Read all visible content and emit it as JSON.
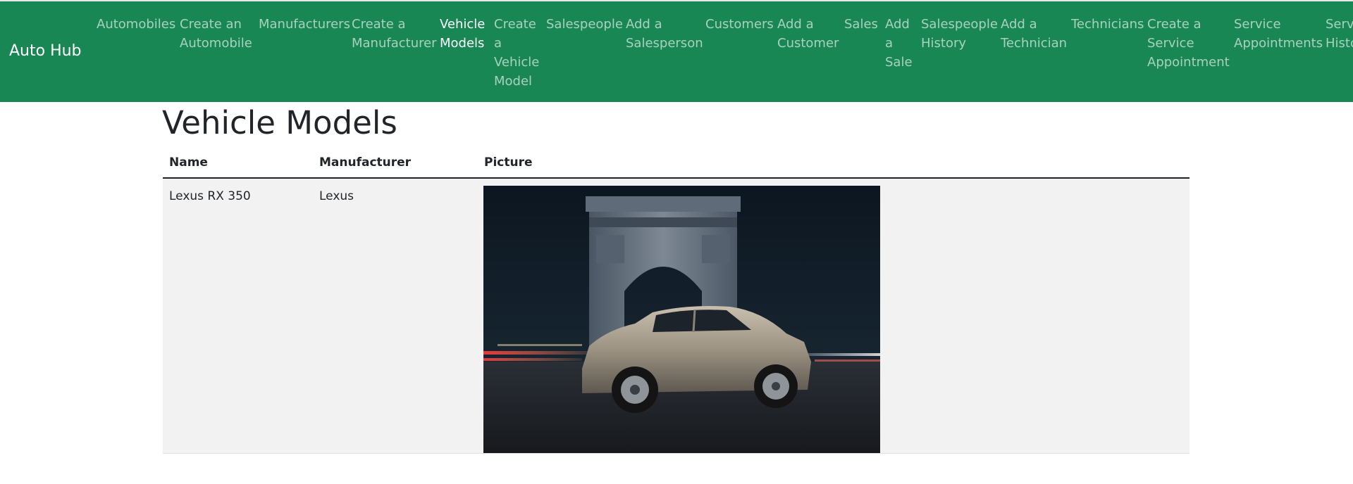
{
  "navbar": {
    "brand": "Auto Hub",
    "items": [
      {
        "label": "Automobiles",
        "active": false
      },
      {
        "label": "Create an Automobile",
        "active": false
      },
      {
        "label": "Manufacturers",
        "active": false
      },
      {
        "label": "Create a Manufacturer",
        "active": false
      },
      {
        "label": "Vehicle Models",
        "active": true
      },
      {
        "label": "Create a Vehicle Model",
        "active": false
      },
      {
        "label": "Salespeople",
        "active": false
      },
      {
        "label": "Add a Salesperson",
        "active": false
      },
      {
        "label": "Customers",
        "active": false
      },
      {
        "label": "Add a Customer",
        "active": false
      },
      {
        "label": "Sales",
        "active": false
      },
      {
        "label": "Add a Sale",
        "active": false
      },
      {
        "label": "Salespeople History",
        "active": false
      },
      {
        "label": "Add a Technician",
        "active": false
      },
      {
        "label": "Technicians",
        "active": false
      },
      {
        "label": "Create a Service Appointment",
        "active": false
      },
      {
        "label": "Service Appointments",
        "active": false
      },
      {
        "label": "Service History",
        "active": false
      }
    ]
  },
  "page": {
    "title": "Vehicle Models"
  },
  "table": {
    "headers": {
      "name": "Name",
      "manufacturer": "Manufacturer",
      "picture": "Picture"
    },
    "rows": [
      {
        "name": "Lexus RX 350",
        "manufacturer": "Lexus",
        "picture_alt": "Lexus RX 350"
      }
    ]
  },
  "colors": {
    "navbar_bg": "#198754",
    "row_stripe": "#f2f2f2",
    "text": "#212529"
  }
}
